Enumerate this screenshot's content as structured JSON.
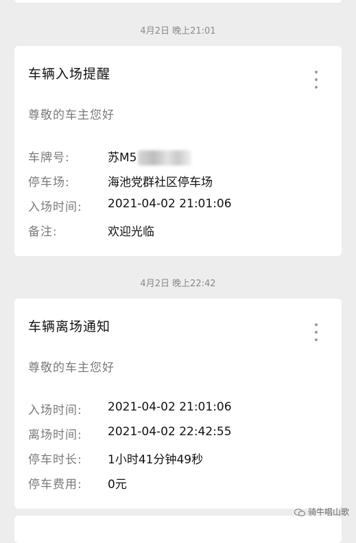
{
  "messages": [
    {
      "timestamp": "4月2日 晚上21:01",
      "title": "车辆入场提醒",
      "greeting": "尊敬的车主您好",
      "rows": [
        {
          "label": "车牌号:",
          "value": "苏M5"
        },
        {
          "label": "停车场:",
          "value": "海池党群社区停车场"
        },
        {
          "label": "入场时间:",
          "value": "2021-04-02 21:01:06"
        },
        {
          "label": "备注:",
          "value": "欢迎光临"
        }
      ]
    },
    {
      "timestamp": "4月2日 晚上22:42",
      "title": "车辆离场通知",
      "greeting": "尊敬的车主您好",
      "rows": [
        {
          "label": "入场时间:",
          "value": "2021-04-02 21:01:06"
        },
        {
          "label": "离场时间:",
          "value": "2021-04-02 22:42:55"
        },
        {
          "label": "停车时长:",
          "value": "1小时41分钟49秒"
        },
        {
          "label": "停车费用:",
          "value": "0元"
        }
      ]
    }
  ],
  "watermark": {
    "text": "骑牛唱山歌",
    "icon": "wechat-icon"
  },
  "colors": {
    "background": "#ededed",
    "card": "#ffffff",
    "muted_text": "#7a7a7a"
  }
}
